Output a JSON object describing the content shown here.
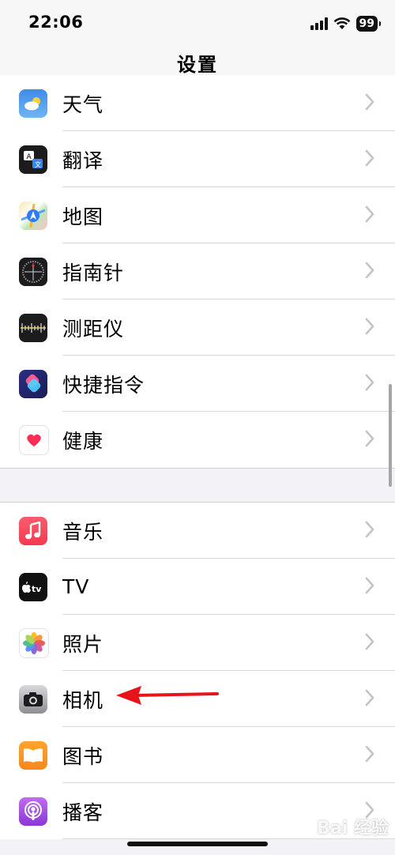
{
  "status": {
    "time": "22:06",
    "battery": "99"
  },
  "nav": {
    "title": "设置"
  },
  "groups": [
    {
      "items": [
        {
          "label": "天气",
          "icon": "weather-icon"
        },
        {
          "label": "翻译",
          "icon": "translate-icon"
        },
        {
          "label": "地图",
          "icon": "maps-icon"
        },
        {
          "label": "指南针",
          "icon": "compass-icon"
        },
        {
          "label": "测距仪",
          "icon": "measure-icon"
        },
        {
          "label": "快捷指令",
          "icon": "shortcuts-icon"
        },
        {
          "label": "健康",
          "icon": "health-icon"
        }
      ]
    },
    {
      "items": [
        {
          "label": "音乐",
          "icon": "music-icon"
        },
        {
          "label": "TV",
          "icon": "tv-icon"
        },
        {
          "label": "照片",
          "icon": "photos-icon"
        },
        {
          "label": "相机",
          "icon": "camera-icon"
        },
        {
          "label": "图书",
          "icon": "books-icon"
        },
        {
          "label": "播客",
          "icon": "podcasts-icon"
        }
      ]
    }
  ],
  "watermark": "Bai 经验",
  "colors": {
    "arrow": "#e8141c",
    "chevron": "#c4c4c7"
  }
}
